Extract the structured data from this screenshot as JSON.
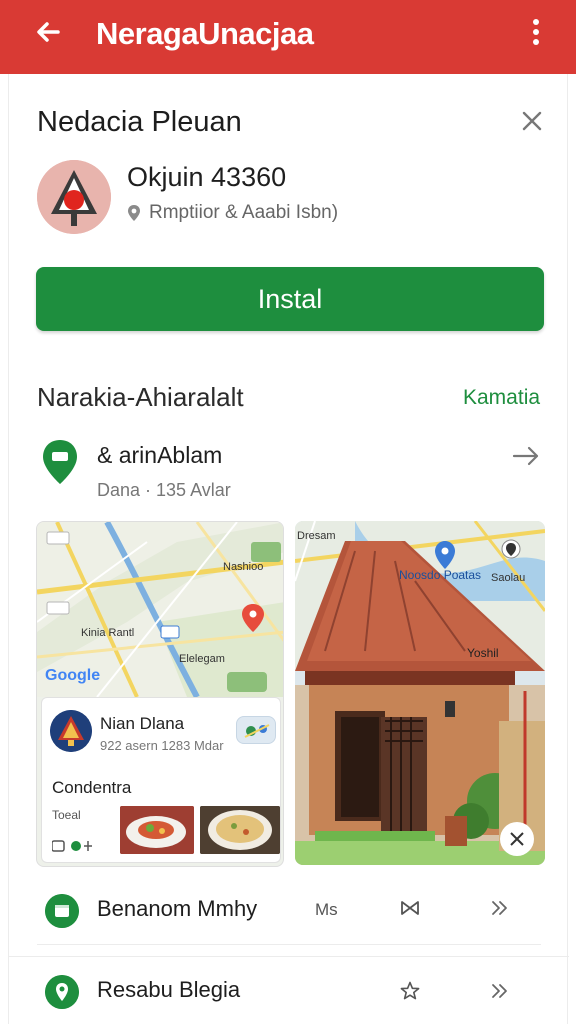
{
  "appbar": {
    "title": "NeragaUnacjaa",
    "back_icon": "arrow-back-icon",
    "more_icon": "more-vert-icon",
    "color": "#d93a34"
  },
  "sheet": {
    "title": "Nedacia Pleuan",
    "close_icon": "close-icon"
  },
  "place": {
    "name": "Okjuin 43360",
    "subtitle": "Rmptiior & Aaabi  Isbn)",
    "pin_icon": "location-pin-icon"
  },
  "install": {
    "label": "Instal",
    "color": "#1e8e3e"
  },
  "section": {
    "title": "Narakia-Ahiaralalt",
    "link": "Kamatia"
  },
  "location": {
    "title": "& arinAblam",
    "subtitle": "Dana · 135 Avlar",
    "icon": "map-marker-icon",
    "arrow_icon": "arrow-forward-icon"
  },
  "map_card": {
    "labels": {
      "nashioo": "Nashioo",
      "kinia": "Kinia Rantl",
      "elegam": "Elelegam",
      "google": "Google"
    },
    "info": {
      "name": "Nian Dlana",
      "meta": "922 asern 1283 Mdar",
      "label": "Condentra",
      "small": "Toeal"
    }
  },
  "photo_card": {
    "labels": {
      "dresam": "Dresam",
      "nosodo": "Noosdo Poatas",
      "saolau": "Saolau",
      "yoshil": "Yoshil"
    },
    "expand_icon": "collapse-icon"
  },
  "rows": [
    {
      "label": "Benanom Mmhy",
      "meta": "Ms",
      "icon": "calendar-icon",
      "action1_icon": "bowtie-icon",
      "action2_icon": "chevron-double-right-icon"
    },
    {
      "label": "Resabu Blegia",
      "icon": "pin-circle-icon",
      "action1_icon": "star-outline-icon",
      "action2_icon": "chevron-double-right-icon"
    }
  ]
}
